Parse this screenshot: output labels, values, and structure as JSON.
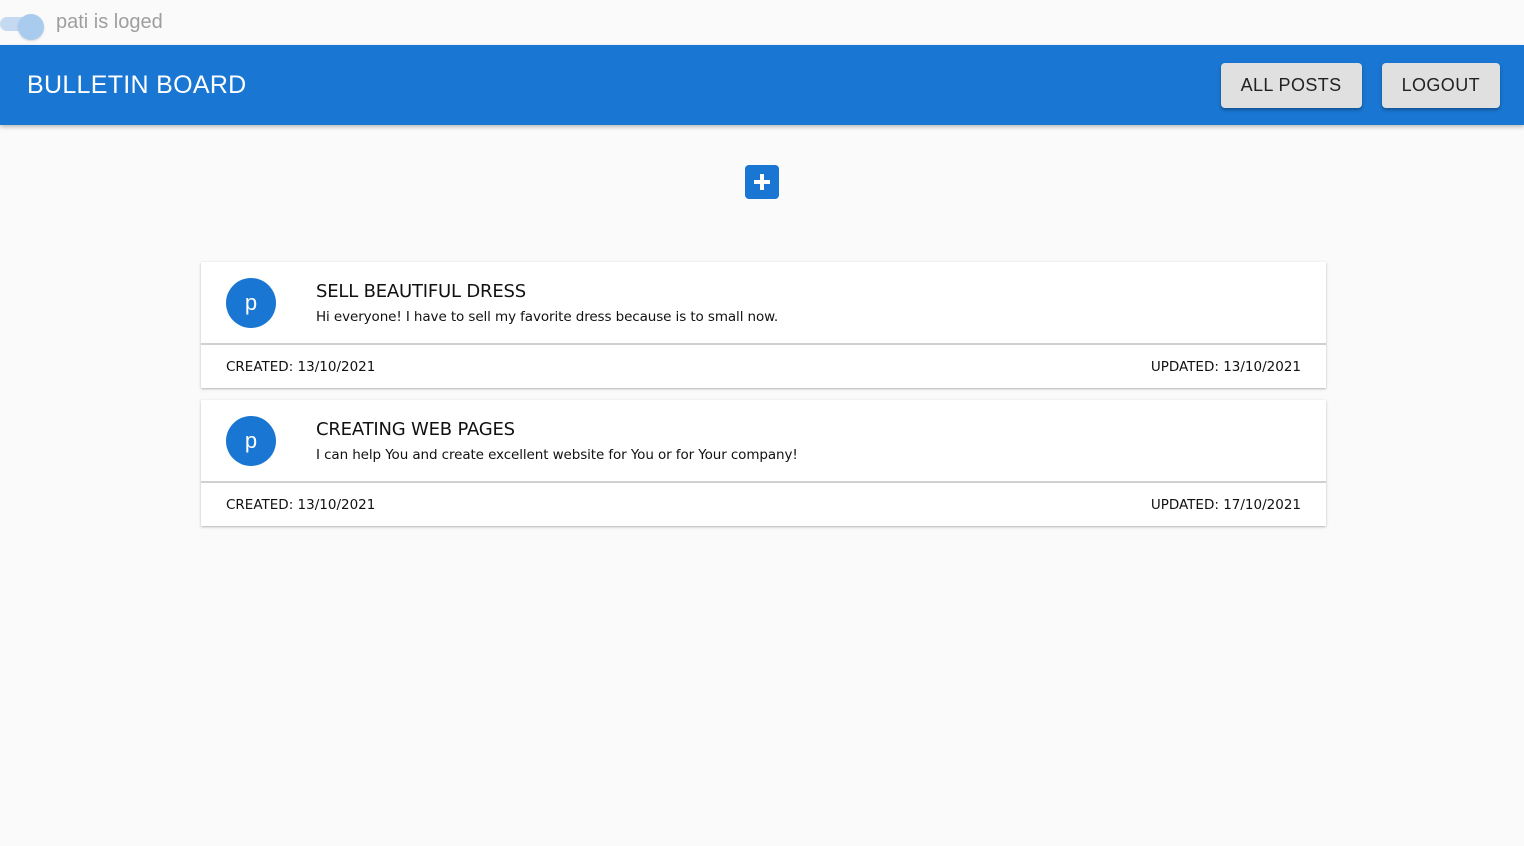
{
  "login": {
    "status_text": "pati is loged",
    "toggle_on": true
  },
  "app_bar": {
    "title": "BULLETIN BOARD",
    "buttons": [
      {
        "label": "ALL POSTS"
      },
      {
        "label": "LOGOUT"
      }
    ]
  },
  "add_button": {
    "icon": "plus-icon"
  },
  "posts": [
    {
      "avatar": "p",
      "title": "SELL BEAUTIFUL DRESS",
      "body": "Hi everyone! I have to sell my favorite dress because is to small now.",
      "created": "CREATED: 13/10/2021",
      "updated": "UPDATED: 13/10/2021"
    },
    {
      "avatar": "p",
      "title": "CREATING WEB PAGES",
      "body": "I can help You and create excellent website for You or for Your company!",
      "created": "CREATED: 13/10/2021",
      "updated": "UPDATED: 17/10/2021"
    }
  ],
  "colors": {
    "primary": "#1976d2",
    "button_bg": "#e0e0e0",
    "page_bg": "#fafafa"
  }
}
